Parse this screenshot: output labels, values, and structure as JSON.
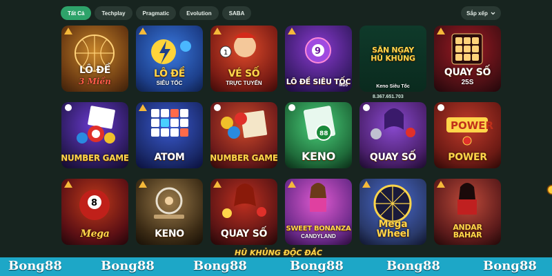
{
  "filters": [
    {
      "label": "Tất Cả",
      "active": true
    },
    {
      "label": "Techplay",
      "active": false
    },
    {
      "label": "Pragmatic",
      "active": false
    },
    {
      "label": "Evolution",
      "active": false
    },
    {
      "label": "SABA",
      "active": false
    }
  ],
  "sort_label": "Sắp xếp",
  "games": [
    {
      "title": "LÔ ĐỀ",
      "sub": "3 Miền",
      "bg": "#6b3a12"
    },
    {
      "title": "LÔ ĐỀ",
      "sub": "SIÊU TỐC",
      "bg": "#1d3f8a"
    },
    {
      "title": "VÉ SỐ",
      "sub": "TRỰC TUYẾN",
      "bg": "#7a1c14"
    },
    {
      "title": "LÔ ĐỀ SIÊU TỐC",
      "sub": "MD5",
      "bg": "#3b1c6b"
    },
    {
      "title": "SĂN NGAY HŨ KHỦNG",
      "sub": "Keno Siêu Tốc",
      "jackpot": "8.367.651.703",
      "bg": "#0f3a2a"
    },
    {
      "title": "QUAY SỐ",
      "sub": "25S",
      "bg": "#4a0f14"
    },
    {
      "title": "NUMBER GAME",
      "sub": "",
      "bg": "#2a1a5a"
    },
    {
      "title": "ATOM",
      "sub": "",
      "bg": "#1a2a6b"
    },
    {
      "title": "NUMBER GAME",
      "sub": "",
      "bg": "#6b1a1a"
    },
    {
      "title": "KENO",
      "sub": "",
      "bg": "#1f6b3a"
    },
    {
      "title": "QUAY SỐ",
      "sub": "",
      "bg": "#4a1f6b"
    },
    {
      "title": "POWER",
      "sub": "",
      "bg": "#6b1a14"
    },
    {
      "title": "Mega",
      "sub": "",
      "bg": "#5a0f14"
    },
    {
      "title": "KENO",
      "sub": "",
      "bg": "#3a2a14"
    },
    {
      "title": "QUAY SỐ",
      "sub": "",
      "bg": "#5a1414"
    },
    {
      "title": "SWEET BONANZA",
      "sub": "CANDYLAND",
      "bg": "#6b2a8a"
    },
    {
      "title": "Mega Wheel",
      "sub": "",
      "bg": "#2a3a6b"
    },
    {
      "title": "ANDAR BAHAR",
      "sub": "",
      "bg": "#5a1a1a"
    }
  ],
  "banner": "HŨ KHỦNG ĐỘC ĐẮC",
  "watermark": "Bong88"
}
